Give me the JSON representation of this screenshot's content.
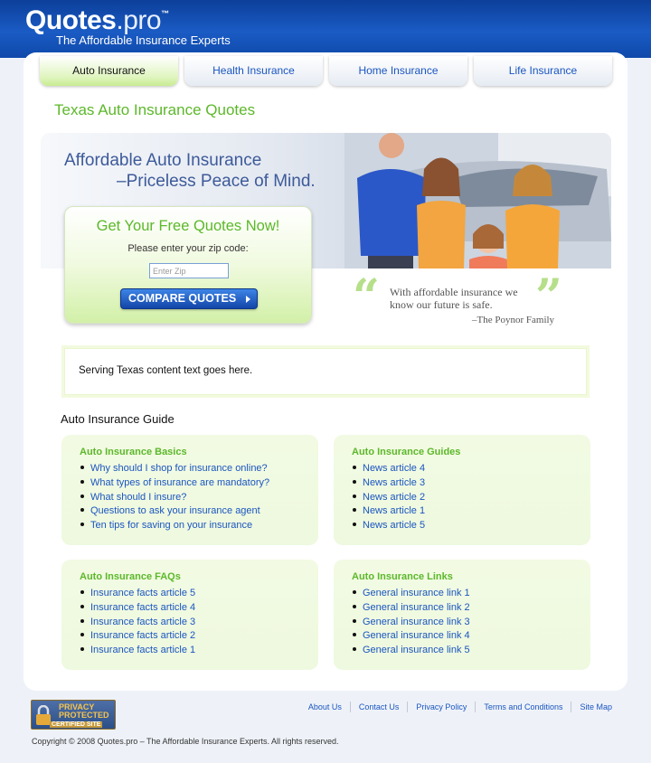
{
  "header": {
    "logo_main": "Quotes",
    "logo_suffix": ".pro",
    "logo_tm": "™",
    "tagline": "The Affordable Insurance Experts"
  },
  "tabs": [
    {
      "label": "Auto Insurance",
      "active": true
    },
    {
      "label": "Health Insurance",
      "active": false
    },
    {
      "label": "Home Insurance",
      "active": false
    },
    {
      "label": "Life Insurance",
      "active": false
    }
  ],
  "page_title": "Texas Auto Insurance Quotes",
  "hero": {
    "line1": "Affordable Auto Insurance",
    "line2": "–Priceless Peace of Mind."
  },
  "quote_box": {
    "title": "Get Your Free Quotes Now!",
    "prompt": "Please enter your zip code:",
    "zip_placeholder": "Enter Zip",
    "button_label": "COMPARE QUOTES"
  },
  "testimonial": {
    "text": "With affordable insurance we know our future is safe.",
    "author": "–The Poynor Family"
  },
  "content_text": "Serving Texas content text goes here.",
  "guide": {
    "title": "Auto Insurance Guide",
    "cards": [
      {
        "title": "Auto Insurance Basics",
        "items": [
          "Why should I shop for insurance online?",
          "What types of insurance are mandatory?",
          "What should I insure?",
          "Questions to ask your insurance agent",
          "Ten tips for saving on your insurance"
        ]
      },
      {
        "title": "Auto Insurance Guides",
        "items": [
          "News article 4",
          "News article 3",
          "News article 2",
          "News article 1",
          "News article 5"
        ]
      },
      {
        "title": "Auto Insurance FAQs",
        "items": [
          "Insurance facts article 5",
          "Insurance facts article 4",
          "Insurance facts article 3",
          "Insurance facts article 2",
          "Insurance facts article 1"
        ]
      },
      {
        "title": "Auto Insurance Links",
        "items": [
          "General insurance link 1",
          "General insurance link 2",
          "General insurance link 3",
          "General insurance link 4",
          "General insurance link 5"
        ]
      }
    ]
  },
  "footer": {
    "badge": {
      "line1": "PRIVACY",
      "line2": "PROTECTED",
      "line3": "CERTIFIED SITE"
    },
    "links": [
      "About Us",
      "Contact Us",
      "Privacy Policy",
      "Terms and Conditions",
      "Site Map"
    ],
    "copyright": "Copyright © 2008 Quotes.pro – The Affordable Insurance Experts. All rights reserved."
  },
  "colors": {
    "brand_blue": "#1a5bc4",
    "accent_green": "#5cb82a",
    "link_blue": "#1a55c0"
  }
}
